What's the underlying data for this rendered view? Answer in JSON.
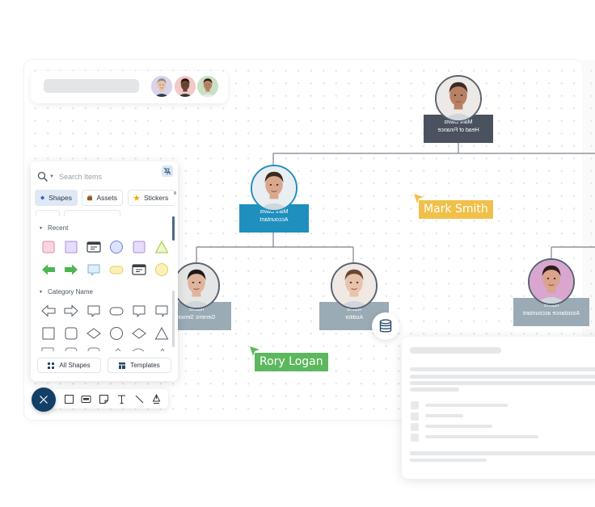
{
  "collab_bar": {
    "avatars": [
      {
        "name": "collaborator-1",
        "bg": "#d9d4ea",
        "skin": "#e8c4a8",
        "hair": "#8a8a8a",
        "shirt": "#2c3a55"
      },
      {
        "name": "collaborator-2",
        "bg": "#f0c9c9",
        "skin": "#6b4330",
        "hair": "#1c1410",
        "shirt": "#2b3a30"
      },
      {
        "name": "collaborator-3",
        "bg": "#c9e0c5",
        "skin": "#b98565",
        "hair": "#2a1e18",
        "shirt": "#e8e8e8"
      }
    ]
  },
  "org_chart": {
    "nodes": [
      {
        "id": "head",
        "name": "Mark Davis",
        "title": "Head of Finance",
        "color": "#4a5260",
        "photo": {
          "bg": "#ece9e6",
          "skin": "#b88163",
          "hair": "#3a2a22"
        }
      },
      {
        "id": "accountant",
        "name": "Mark Davis",
        "title": "Accountant",
        "color": "#1f8fbd",
        "photo": {
          "bg": "#e9eef2",
          "skin": "#d9a88c",
          "hair": "#3b2a20"
        }
      },
      {
        "id": "generic-senior",
        "name": "Name",
        "title": "Generic Senior",
        "color": "#9aabb6",
        "photo": {
          "bg": "#e6e6e6",
          "skin": "#e0b49c",
          "hair": "#1f1a18"
        }
      },
      {
        "id": "auditor",
        "name": "Name",
        "title": "Auditor",
        "color": "#9aabb6",
        "photo": {
          "bg": "#efe8e3",
          "skin": "#e9c2ab",
          "hair": "#6a4634"
        }
      },
      {
        "id": "assistant-accountant",
        "name": "Name",
        "title": "Assistance accountant",
        "color": "#9aabb6",
        "photo": {
          "bg": "#d8a6cf",
          "skin": "#d9a48b",
          "hair": "#2c1d18"
        }
      }
    ]
  },
  "palette": {
    "search_placeholder": "Search Items",
    "tabs": [
      {
        "label": "Shapes",
        "icon": "diamond-icon",
        "active": true
      },
      {
        "label": "Assets",
        "icon": "briefcase-icon",
        "active": false
      },
      {
        "label": "Stickers",
        "icon": "star-icon",
        "active": false
      }
    ],
    "sections": [
      {
        "label": "Recent"
      },
      {
        "label": "Category Name"
      }
    ],
    "recent_shapes": [
      "pink-square",
      "lilac-square",
      "window-card",
      "blue-circle",
      "lilac-square-2",
      "green-triangle",
      "green-arrow-left",
      "green-arrow-right",
      "blue-callout",
      "yellow-pill",
      "window-card-2",
      "yellow-circle"
    ],
    "category_shapes": [
      "arrow-left-outline",
      "arrow-right-outline",
      "callout-outline",
      "pill-outline",
      "callout-outline-2",
      "callout-outline-3",
      "square-outline",
      "rounded-square-outline",
      "diamond-outline",
      "circle-outline",
      "diamond-outline-2",
      "triangle-outline"
    ],
    "footer": {
      "all_shapes_label": "All Shapes",
      "templates_label": "Templates"
    }
  },
  "toolbar": {
    "tools": [
      "rectangle-tool",
      "card-tool",
      "sticky-note-tool",
      "text-tool",
      "line-tool",
      "pen-tool"
    ]
  },
  "cursors": [
    {
      "label": "Mark Smith",
      "color": "#f0c04a"
    },
    {
      "label": "Rory Logan",
      "color": "#5cb85c"
    }
  ],
  "colors": {
    "fab": "#123f66",
    "accent": "#1f8fbd"
  }
}
